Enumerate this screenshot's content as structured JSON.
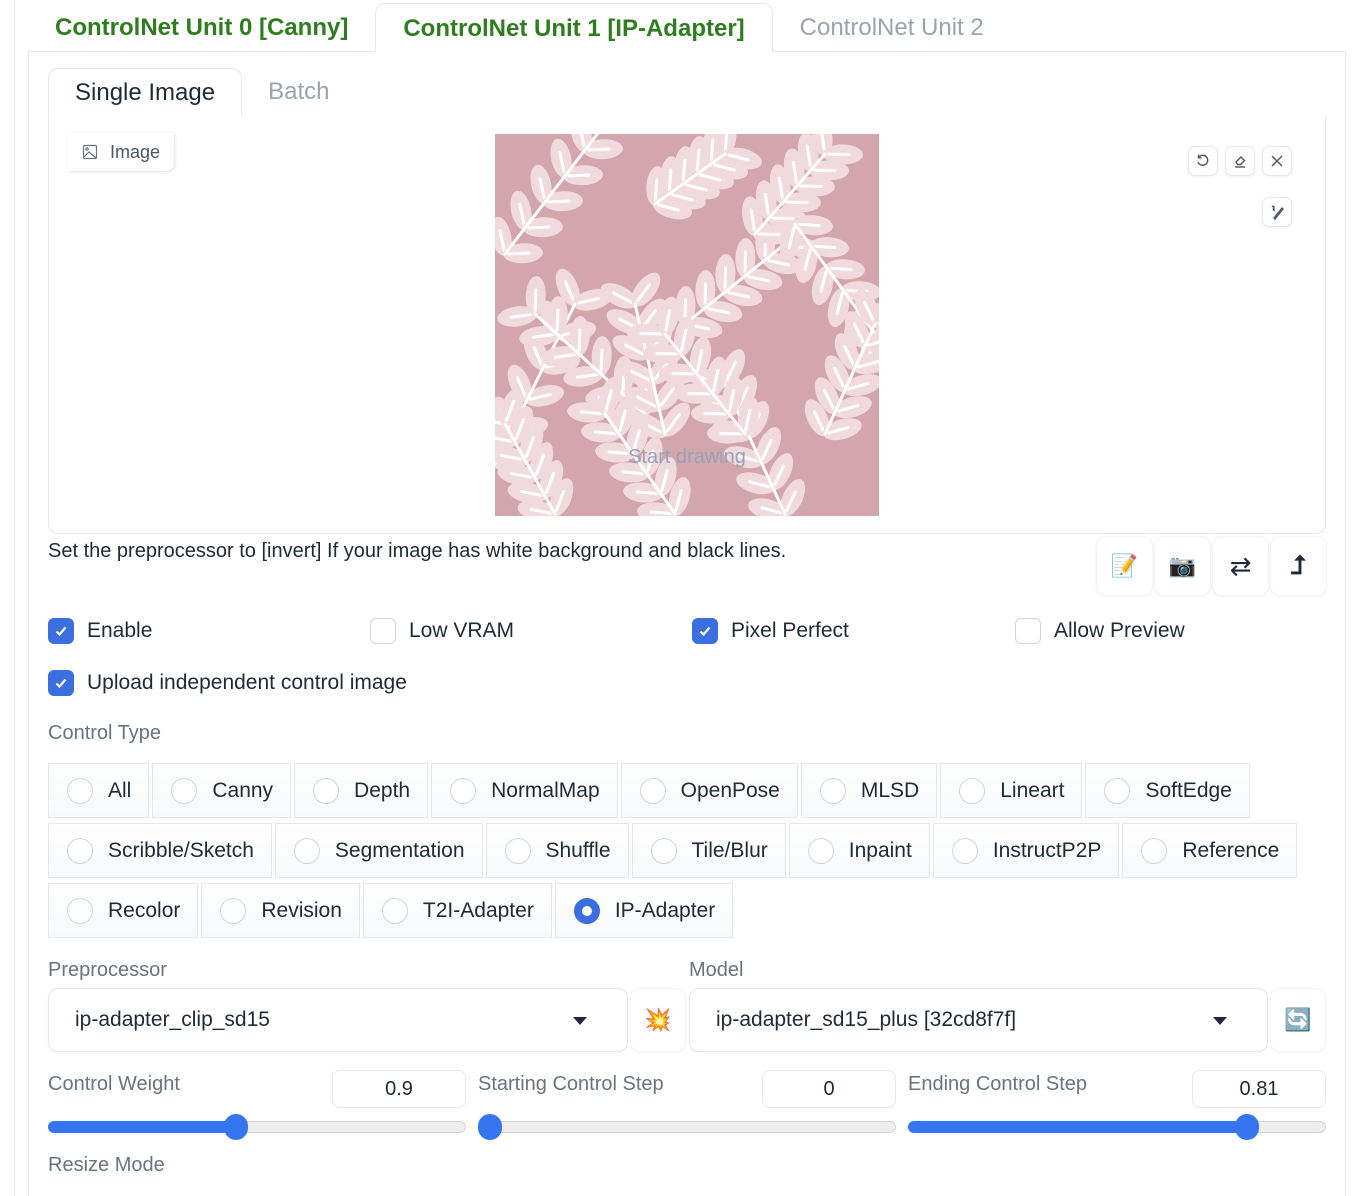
{
  "unit_tabs": [
    {
      "label": "ControlNet Unit 0 [Canny]",
      "active": false
    },
    {
      "label": "ControlNet Unit 1 [IP-Adapter]",
      "active": true
    },
    {
      "label": "ControlNet Unit 2",
      "active": false
    }
  ],
  "sub_tabs": [
    {
      "label": "Single Image",
      "active": true
    },
    {
      "label": "Batch",
      "active": false
    }
  ],
  "image_panel": {
    "label": "Image",
    "placeholder_overlay": "Start drawing",
    "tools": [
      "undo-icon",
      "eraser-icon",
      "close-icon",
      "brush-icon"
    ],
    "image_colors": {
      "background": "#d3a5ad",
      "leaf": "#f0dade",
      "stem": "#ffffff"
    }
  },
  "hint_text": "Set the preprocessor to [invert] If your image has white background and black lines.",
  "action_buttons": [
    {
      "name": "edit-notepad-icon",
      "glyph": "📝"
    },
    {
      "name": "camera-icon",
      "glyph": "📷"
    },
    {
      "name": "swap-arrows-icon",
      "glyph": "⇄"
    },
    {
      "name": "send-dimensions-icon",
      "glyph": "↰"
    }
  ],
  "checkboxes": {
    "enable": {
      "label": "Enable",
      "checked": true
    },
    "low_vram": {
      "label": "Low VRAM",
      "checked": false
    },
    "pixel_perfect": {
      "label": "Pixel Perfect",
      "checked": true
    },
    "allow_preview": {
      "label": "Allow Preview",
      "checked": false
    },
    "upload_independent": {
      "label": "Upload independent control image",
      "checked": true
    }
  },
  "control_type": {
    "label": "Control Type",
    "rows": [
      [
        "All",
        "Canny",
        "Depth",
        "NormalMap",
        "OpenPose",
        "MLSD",
        "Lineart",
        "SoftEdge"
      ],
      [
        "Scribble/Sketch",
        "Segmentation",
        "Shuffle",
        "Tile/Blur",
        "Inpaint",
        "InstructP2P",
        "Reference"
      ],
      [
        "Recolor",
        "Revision",
        "T2I-Adapter",
        "IP-Adapter"
      ]
    ],
    "selected": "IP-Adapter"
  },
  "preprocessor": {
    "label": "Preprocessor",
    "value": "ip-adapter_clip_sd15",
    "run_icon": "💥"
  },
  "model": {
    "label": "Model",
    "value": "ip-adapter_sd15_plus [32cd8f7f]",
    "refresh_icon": "🔄"
  },
  "sliders": [
    {
      "label": "Control Weight",
      "value": "0.9",
      "fraction": 0.45
    },
    {
      "label": "Starting Control Step",
      "value": "0",
      "fraction": 0.0
    },
    {
      "label": "Ending Control Step",
      "value": "0.81",
      "fraction": 0.81
    }
  ],
  "resize_mode": {
    "label": "Resize Mode"
  },
  "colors": {
    "accent": "#3b6fe0",
    "tab_green": "#2e7d1e",
    "slider": "#3576f0"
  }
}
